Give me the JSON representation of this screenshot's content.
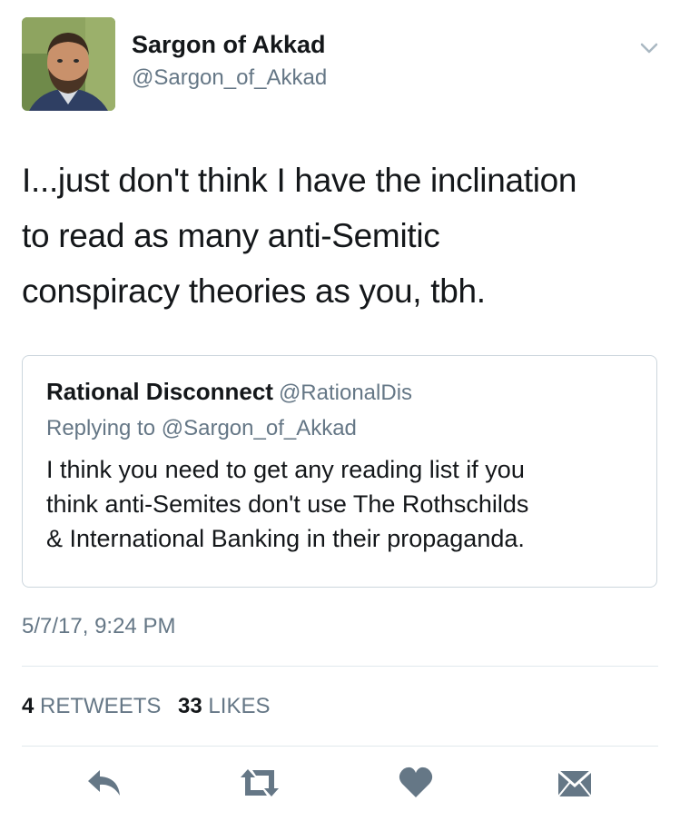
{
  "author": {
    "name": "Sargon of Akkad",
    "handle": "@Sargon_of_Akkad"
  },
  "tweet": {
    "lines": [
      "I...just don't think I have the inclination",
      "to read as many anti-Semitic",
      "conspiracy theories as you, tbh."
    ],
    "timestamp": "5/7/17, 9:24 PM"
  },
  "quoted": {
    "name": "Rational Disconnect",
    "handle": "@RationalDis",
    "replying_to": "Replying to @Sargon_of_Akkad",
    "lines": [
      "I think you need to get any reading list if you",
      "think anti-Semites don't use The Rothschilds",
      "& International Banking in their propaganda."
    ]
  },
  "stats": {
    "retweets_count": "4",
    "retweets_label": "RETWEETS",
    "likes_count": "33",
    "likes_label": "LIKES"
  },
  "icons": {
    "menu": "chevron-down-icon",
    "reply": "reply-icon",
    "retweet": "retweet-icon",
    "like": "heart-icon",
    "dm": "envelope-icon"
  },
  "colors": {
    "icon_gray": "#657786",
    "text": "#14171a",
    "secondary": "#657786",
    "border": "#ccd6dd"
  }
}
